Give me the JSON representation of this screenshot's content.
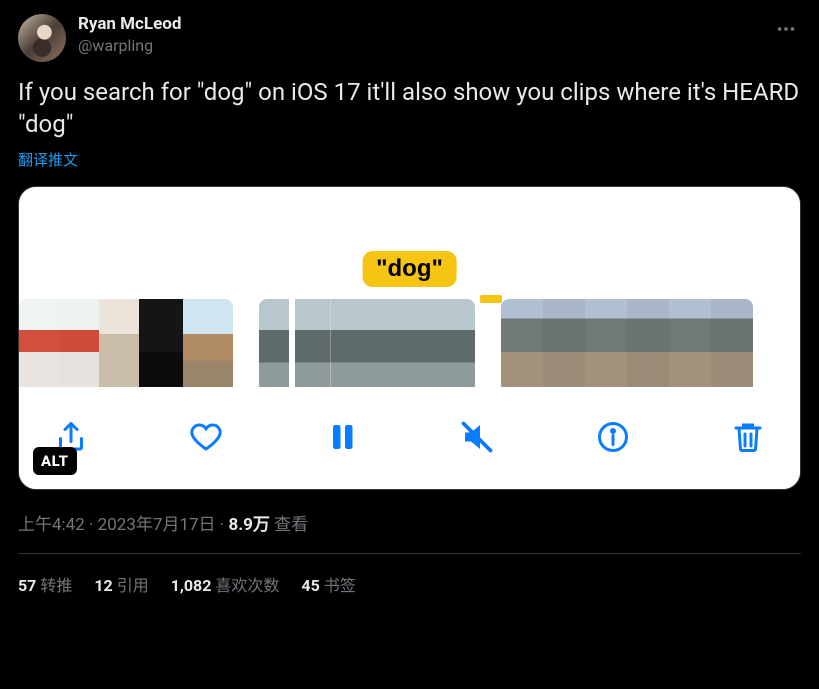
{
  "author": {
    "display_name": "Ryan McLeod",
    "handle": "@warpling"
  },
  "tweet_text": "If you search for \"dog\" on iOS 17 it'll also show you clips where it's HEARD \"dog\"",
  "translate_label": "翻译推文",
  "media": {
    "badge_text": "\"dog\"",
    "alt_label": "ALT"
  },
  "meta": {
    "time": "上午4:42",
    "date": "2023年7月17日",
    "views_number": "8.9万",
    "views_label": "查看"
  },
  "stats": {
    "retweets": {
      "count": "57",
      "label": "转推"
    },
    "quotes": {
      "count": "12",
      "label": "引用"
    },
    "likes": {
      "count": "1,082",
      "label": "喜欢次数"
    },
    "bookmarks": {
      "count": "45",
      "label": "书签"
    }
  }
}
